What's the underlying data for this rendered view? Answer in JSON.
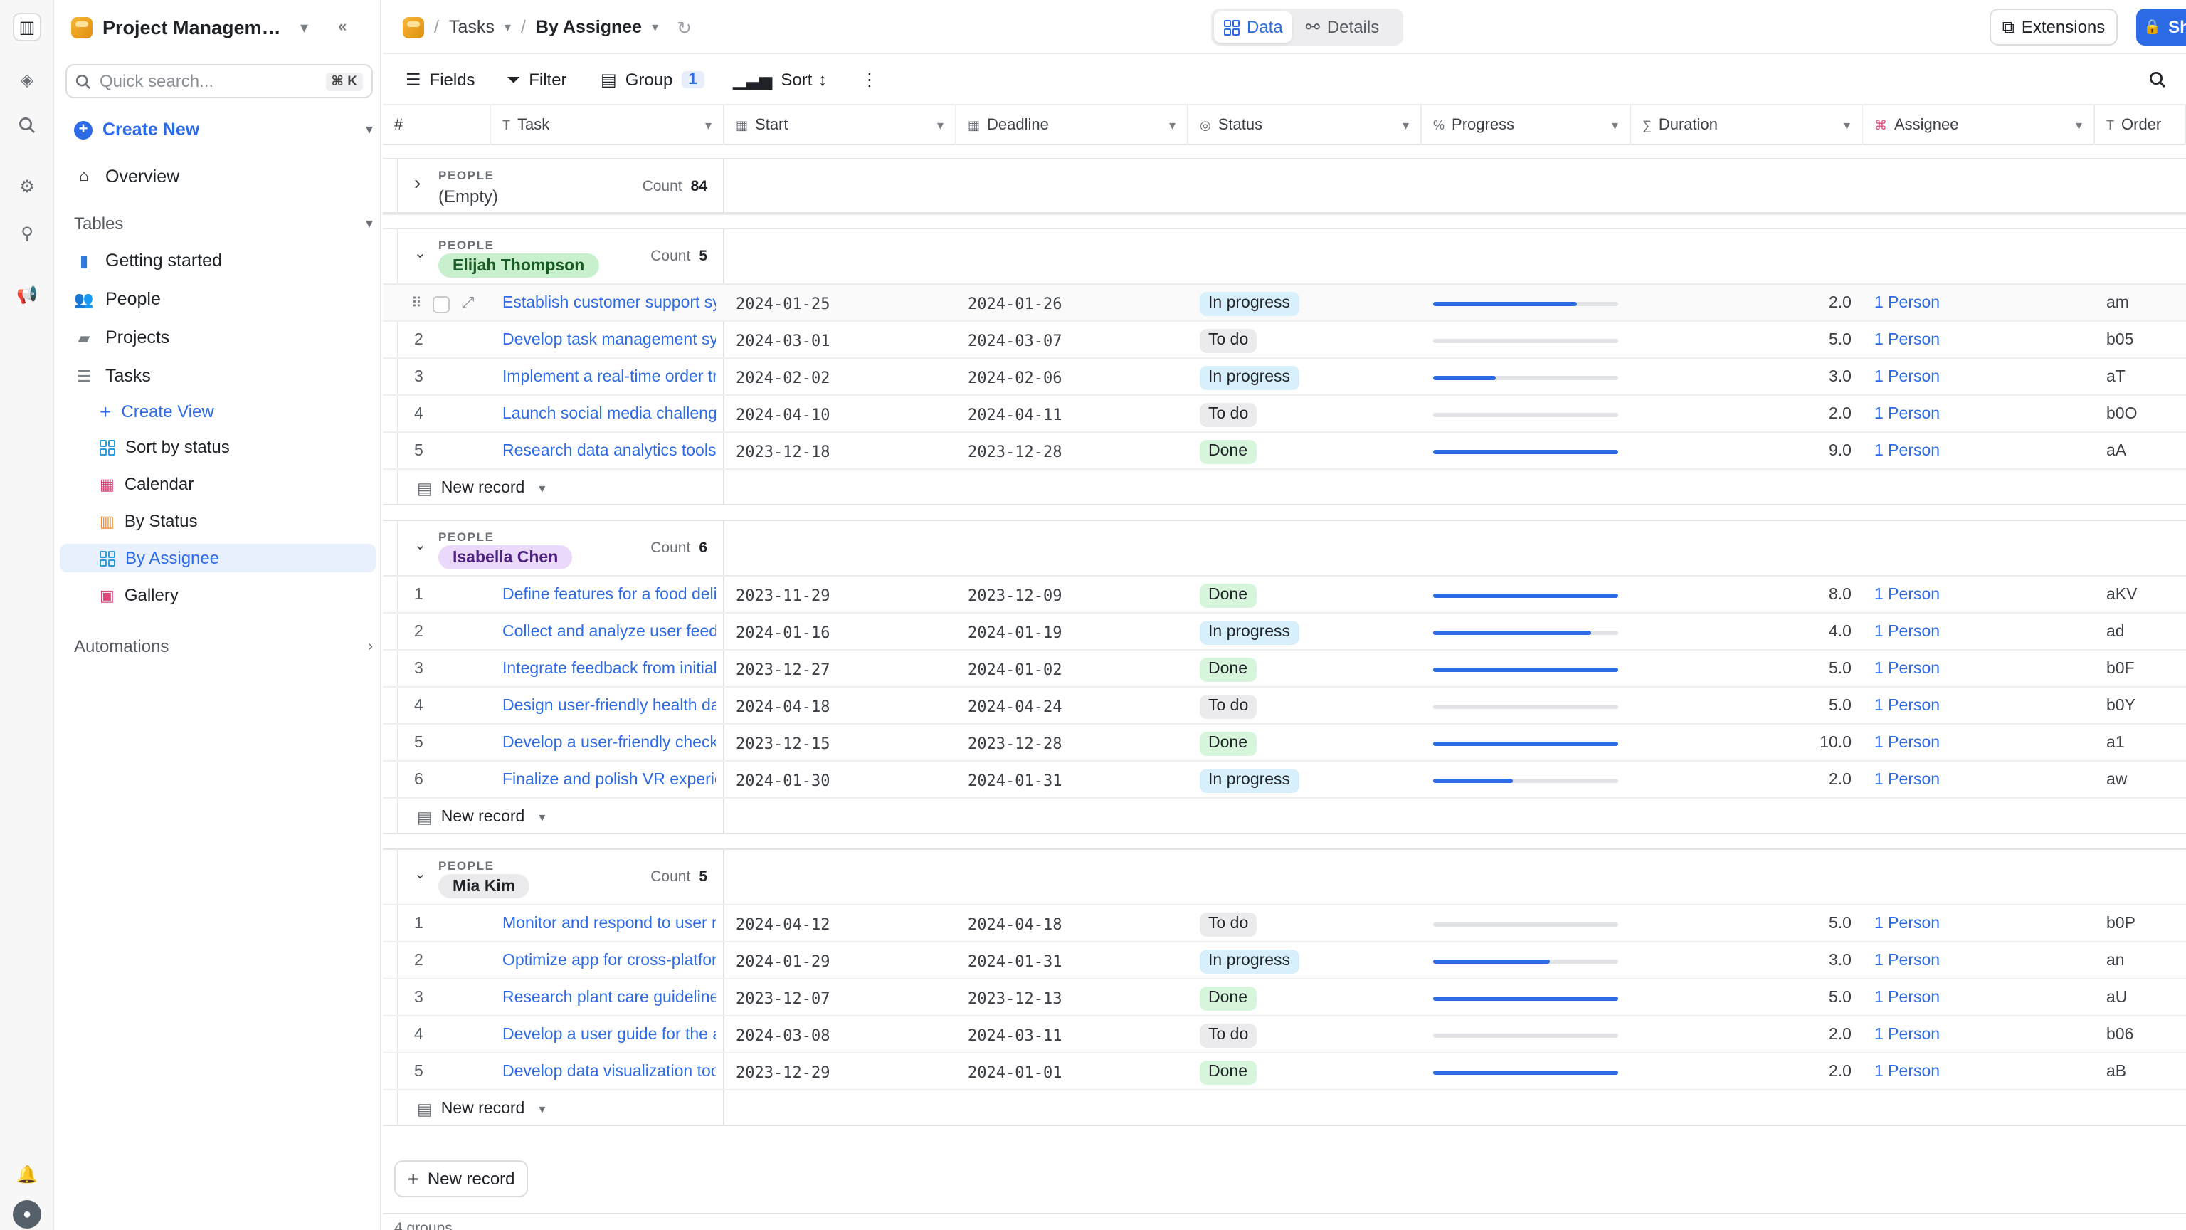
{
  "sidebar": {
    "title": "Project Management",
    "search_placeholder": "Quick search...",
    "search_shortcut": "⌘ K",
    "create_new": "Create New",
    "overview": "Overview",
    "tables_section": "Tables",
    "tables": [
      {
        "label": "Getting started",
        "icon": "book-icon"
      },
      {
        "label": "People",
        "icon": "people-icon"
      },
      {
        "label": "Projects",
        "icon": "folder-icon"
      },
      {
        "label": "Tasks",
        "icon": "checklist-icon"
      }
    ],
    "views": [
      {
        "label": "Create View",
        "icon": "plus-icon"
      },
      {
        "label": "Sort by status",
        "icon": "grid-icon"
      },
      {
        "label": "Calendar",
        "icon": "calendar-icon"
      },
      {
        "label": "By Status",
        "icon": "kanban-icon"
      },
      {
        "label": "By Assignee",
        "icon": "grid-icon"
      },
      {
        "label": "Gallery",
        "icon": "gallery-icon"
      }
    ],
    "automations": "Automations"
  },
  "topbar": {
    "breadcrumb_table": "Tasks",
    "breadcrumb_view": "By Assignee",
    "tab_data": "Data",
    "tab_details": "Details",
    "extensions": "Extensions",
    "share": "Share"
  },
  "toolbar": {
    "fields": "Fields",
    "filter": "Filter",
    "group": "Group",
    "group_count": "1",
    "sort": "Sort"
  },
  "columns": [
    {
      "label": "#",
      "icon": "hash-icon"
    },
    {
      "label": "Task",
      "icon": "text-icon"
    },
    {
      "label": "Start",
      "icon": "calendar-icon"
    },
    {
      "label": "Deadline",
      "icon": "calendar-icon"
    },
    {
      "label": "Status",
      "icon": "status-icon"
    },
    {
      "label": "Progress",
      "icon": "percent-icon"
    },
    {
      "label": "Duration",
      "icon": "formula-icon"
    },
    {
      "label": "Assignee",
      "icon": "link-icon"
    },
    {
      "label": "Order",
      "icon": "text-icon"
    }
  ],
  "group_label": "PEOPLE",
  "count_label": "Count",
  "new_record": "New record",
  "groups": [
    {
      "name": "(Empty)",
      "count": "84",
      "collapsed": true,
      "rows": []
    },
    {
      "name": "Elijah Thompson",
      "count": "5",
      "collapsed": false,
      "pill_bg": "#c9f0cd",
      "pill_fg": "#1a5c25",
      "rows": [
        {
          "num": "1",
          "task": "Establish customer support system",
          "start": "2024-01-25",
          "deadline": "2024-01-26",
          "status": "In progress",
          "progress": 0.78,
          "duration": "2.0",
          "assignee": "1 Person",
          "order": "am"
        },
        {
          "num": "2",
          "task": "Develop task management system",
          "start": "2024-03-01",
          "deadline": "2024-03-07",
          "status": "To do",
          "progress": 0,
          "duration": "5.0",
          "assignee": "1 Person",
          "order": "b05"
        },
        {
          "num": "3",
          "task": "Implement a real-time order tracking",
          "start": "2024-02-02",
          "deadline": "2024-02-06",
          "status": "In progress",
          "progress": 0.34,
          "duration": "3.0",
          "assignee": "1 Person",
          "order": "aT"
        },
        {
          "num": "4",
          "task": "Launch social media challenge",
          "start": "2024-04-10",
          "deadline": "2024-04-11",
          "status": "To do",
          "progress": 0,
          "duration": "2.0",
          "assignee": "1 Person",
          "order": "b0O"
        },
        {
          "num": "5",
          "task": "Research data analytics tools",
          "start": "2023-12-18",
          "deadline": "2023-12-28",
          "status": "Done",
          "progress": 1,
          "duration": "9.0",
          "assignee": "1 Person",
          "order": "aA"
        }
      ]
    },
    {
      "name": "Isabella Chen",
      "count": "6",
      "collapsed": false,
      "pill_bg": "#ead9fb",
      "pill_fg": "#4f2380",
      "rows": [
        {
          "num": "1",
          "task": "Define features for a food delivery app",
          "start": "2023-11-29",
          "deadline": "2023-12-09",
          "status": "Done",
          "progress": 1,
          "duration": "8.0",
          "assignee": "1 Person",
          "order": "aKV"
        },
        {
          "num": "2",
          "task": "Collect and analyze user feedback",
          "start": "2024-01-16",
          "deadline": "2024-01-19",
          "status": "In progress",
          "progress": 0.85,
          "duration": "4.0",
          "assignee": "1 Person",
          "order": "ad"
        },
        {
          "num": "3",
          "task": "Integrate feedback from initial users",
          "start": "2023-12-27",
          "deadline": "2024-01-02",
          "status": "Done",
          "progress": 1,
          "duration": "5.0",
          "assignee": "1 Person",
          "order": "b0F"
        },
        {
          "num": "4",
          "task": "Design user-friendly health dashboard",
          "start": "2024-04-18",
          "deadline": "2024-04-24",
          "status": "To do",
          "progress": 0,
          "duration": "5.0",
          "assignee": "1 Person",
          "order": "b0Y"
        },
        {
          "num": "5",
          "task": "Develop a user-friendly checkout",
          "start": "2023-12-15",
          "deadline": "2023-12-28",
          "status": "Done",
          "progress": 1,
          "duration": "10.0",
          "assignee": "1 Person",
          "order": "a1"
        },
        {
          "num": "6",
          "task": "Finalize and polish VR experience",
          "start": "2024-01-30",
          "deadline": "2024-01-31",
          "status": "In progress",
          "progress": 0.43,
          "duration": "2.0",
          "assignee": "1 Person",
          "order": "aw"
        }
      ]
    },
    {
      "name": "Mia Kim",
      "count": "5",
      "collapsed": false,
      "pill_bg": "#ebebee",
      "pill_fg": "#1f2328",
      "rows": [
        {
          "num": "1",
          "task": "Monitor and respond to user reviews",
          "start": "2024-04-12",
          "deadline": "2024-04-18",
          "status": "To do",
          "progress": 0,
          "duration": "5.0",
          "assignee": "1 Person",
          "order": "b0P"
        },
        {
          "num": "2",
          "task": "Optimize app for cross-platform use",
          "start": "2024-01-29",
          "deadline": "2024-01-31",
          "status": "In progress",
          "progress": 0.63,
          "duration": "3.0",
          "assignee": "1 Person",
          "order": "an"
        },
        {
          "num": "3",
          "task": "Research plant care guidelines",
          "start": "2023-12-07",
          "deadline": "2023-12-13",
          "status": "Done",
          "progress": 1,
          "duration": "5.0",
          "assignee": "1 Person",
          "order": "aU"
        },
        {
          "num": "4",
          "task": "Develop a user guide for the app",
          "start": "2024-03-08",
          "deadline": "2024-03-11",
          "status": "To do",
          "progress": 0,
          "duration": "2.0",
          "assignee": "1 Person",
          "order": "b06"
        },
        {
          "num": "5",
          "task": "Develop data visualization tools",
          "start": "2023-12-29",
          "deadline": "2024-01-01",
          "status": "Done",
          "progress": 1,
          "duration": "2.0",
          "assignee": "1 Person",
          "order": "aB"
        }
      ]
    }
  ],
  "footer": "4 groups",
  "colors": {
    "accent": "#2c6ae6",
    "in_progress": "#d7f0fb",
    "to_do": "#ebebee",
    "done": "#d6f5da"
  }
}
